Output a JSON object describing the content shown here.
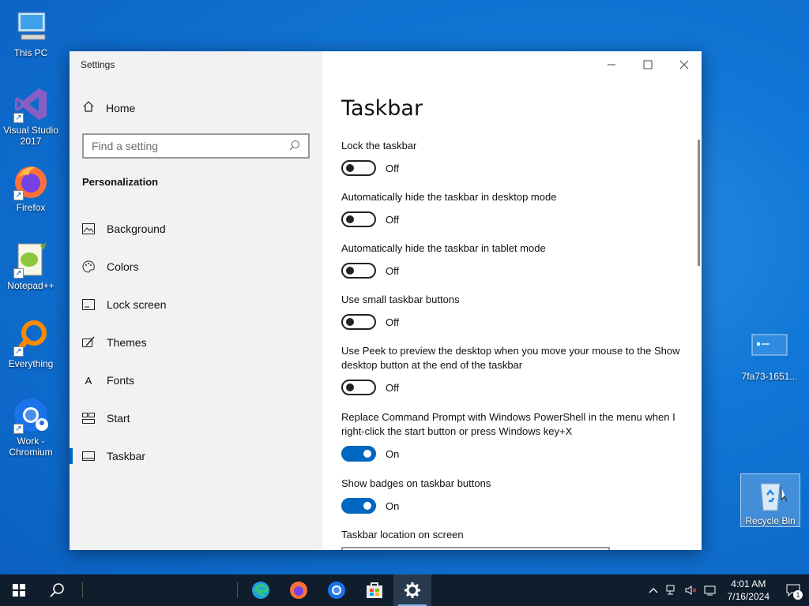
{
  "desktop": {
    "icons": {
      "this_pc": "This PC",
      "visual_studio": "Visual Studio 2017",
      "firefox": "Firefox",
      "notepadpp": "Notepad++",
      "everything": "Everything",
      "work_chromium": "Work - Chromium",
      "file": "7fa73-1651...",
      "recycle_bin": "Recycle Bin"
    }
  },
  "window": {
    "title": "Settings",
    "controls": {
      "minimize": "—",
      "maximize": "☐",
      "close": "✕"
    }
  },
  "nav": {
    "home": "Home",
    "search_placeholder": "Find a setting",
    "section": "Personalization",
    "items": [
      {
        "label": "Background",
        "icon": "image-icon"
      },
      {
        "label": "Colors",
        "icon": "palette-icon"
      },
      {
        "label": "Lock screen",
        "icon": "lock-screen-icon"
      },
      {
        "label": "Themes",
        "icon": "brush-icon"
      },
      {
        "label": "Fonts",
        "icon": "font-icon"
      },
      {
        "label": "Start",
        "icon": "start-layout-icon"
      },
      {
        "label": "Taskbar",
        "icon": "taskbar-icon"
      }
    ],
    "active": "Taskbar"
  },
  "content": {
    "title": "Taskbar",
    "settings": [
      {
        "label": "Lock the taskbar",
        "state": "Off",
        "on": false
      },
      {
        "label": "Automatically hide the taskbar in desktop mode",
        "state": "Off",
        "on": false
      },
      {
        "label": "Automatically hide the taskbar in tablet mode",
        "state": "Off",
        "on": false
      },
      {
        "label": "Use small taskbar buttons",
        "state": "Off",
        "on": false
      },
      {
        "label": "Use Peek to preview the desktop when you move your mouse to the Show desktop button at the end of the taskbar",
        "state": "Off",
        "on": false
      },
      {
        "label": "Replace Command Prompt with Windows PowerShell in the menu when I right-click the start button or press Windows key+X",
        "state": "On",
        "on": true
      },
      {
        "label": "Show badges on taskbar buttons",
        "state": "On",
        "on": true
      }
    ],
    "location_label": "Taskbar location on screen"
  },
  "taskbar": {
    "clock_time": "4:01 AM",
    "clock_date": "7/16/2024",
    "notification_count": "1"
  },
  "colors": {
    "accent": "#0067c0",
    "taskbar": "#101d2c"
  }
}
